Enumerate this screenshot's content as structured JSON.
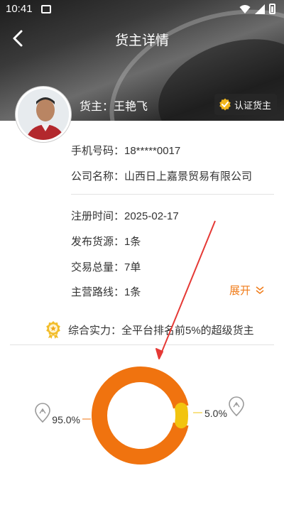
{
  "status_bar": {
    "time": "10:41"
  },
  "header": {
    "title": "货主详情"
  },
  "owner": {
    "label": "货主：王艳飞",
    "badge": "认证货主"
  },
  "contact": {
    "phone": "手机号码：18*****0017",
    "company": "公司名称：山西日上嘉景贸易有限公司"
  },
  "stats": {
    "register": "注册时间：2025-02-17",
    "sources": "发布货源：1条",
    "volume": "交易总量：7单",
    "routes": "主营路线：1条",
    "expand_label": "展开"
  },
  "strength": {
    "text": "综合实力：全平台排名前5%的超级货主"
  },
  "colors": {
    "accent": "#f07c1a",
    "ring_main": "#f0730f",
    "ring_minor": "#f2c40f",
    "annotation": "#e53935"
  },
  "chart_data": {
    "type": "pie",
    "donut": true,
    "slices": [
      {
        "value": 95.0,
        "label": "95.0%",
        "color": "#f0730f"
      },
      {
        "value": 5.0,
        "label": "5.0%",
        "color": "#f2c40f"
      }
    ]
  }
}
